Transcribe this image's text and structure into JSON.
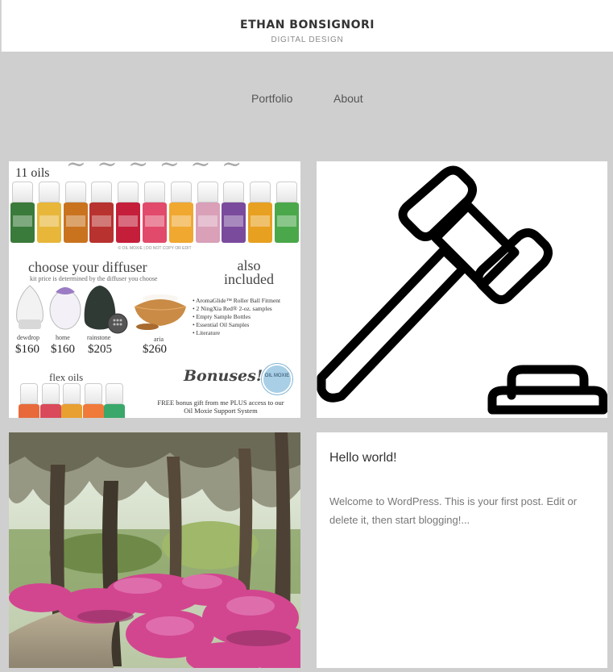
{
  "header": {
    "site_title": "ETHAN BONSIGNORI",
    "tagline": "DIGITAL DESIGN"
  },
  "nav": {
    "items": [
      {
        "label": "Portfolio"
      },
      {
        "label": "About"
      }
    ]
  },
  "cards": {
    "oils": {
      "count_label": "11 oils",
      "copyright": "© OIL MOXIE | DO NOT COPY OR EDIT",
      "diffuser_heading": "choose your diffuser",
      "diffuser_subheading": "kit price is determined by the diffuser you choose",
      "also_heading": "also included",
      "diffusers": [
        {
          "name": "dewdrop",
          "price": "$160"
        },
        {
          "name": "home",
          "price": "$160"
        },
        {
          "name": "rainstone",
          "price": "$205"
        },
        {
          "name": "aria",
          "price": "$260"
        }
      ],
      "included": [
        "• AromaGlide™ Roller Ball Fitment",
        "• 2 NingXia Red® 2-oz. samples",
        "• Empty Sample Bottles",
        "• Essential Oil Samples",
        "• Literature"
      ],
      "flex_heading": "flex oils",
      "bonuses_heading": "Bonuses!",
      "bonus_text": "FREE bonus gift from me PLUS access to our Oil Moxie Support System",
      "seal_text": "OIL MOXIE",
      "colors": {
        "bottles": [
          "#3a7a3a",
          "#e8b73a",
          "#c9731f",
          "#b8322f",
          "#c41e3a",
          "#e14a6a",
          "#f0a830",
          "#d9a0b8",
          "#7a4a9c",
          "#e8a020",
          "#4aa84a"
        ],
        "flex": [
          "#e86a3a",
          "#d94a5a",
          "#e8a030",
          "#f07a3a",
          "#3aa86a"
        ]
      }
    },
    "gavel": {
      "icon": "gavel-icon"
    },
    "photo": {
      "icon": "azalea-trees-photo"
    },
    "post": {
      "title": "Hello world!",
      "excerpt": "Welcome to WordPress. This is your first post. Edit or delete it, then start blogging!..."
    }
  }
}
